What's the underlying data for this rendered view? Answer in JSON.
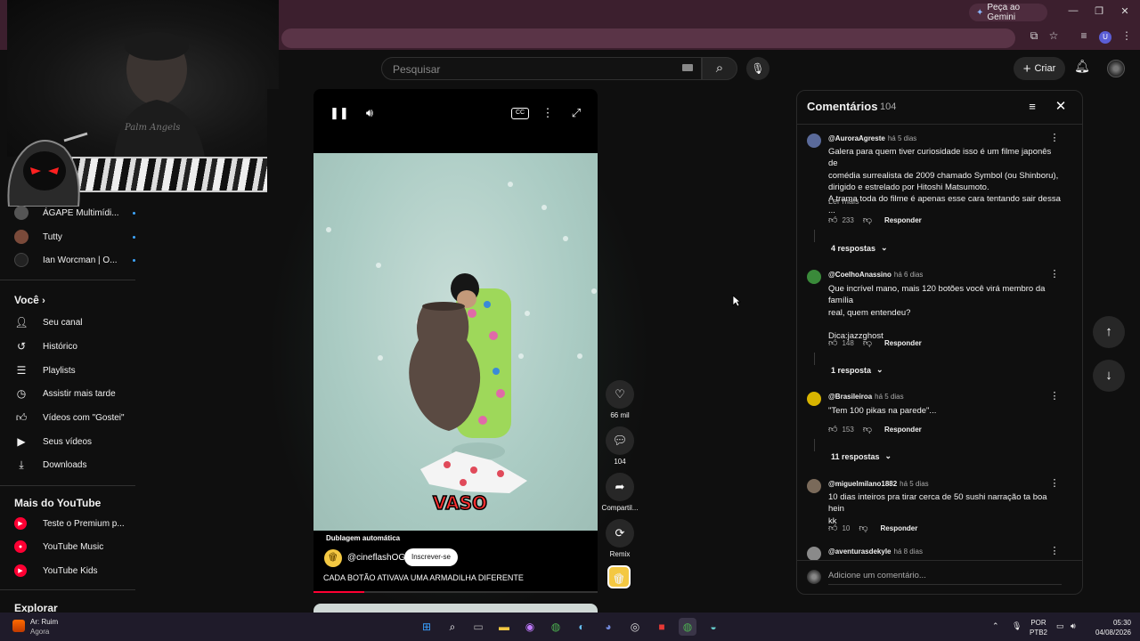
{
  "browser": {
    "gemini_label": "Peça ao Gemini",
    "profile_initial": "U"
  },
  "header": {
    "search_placeholder": "Pesquisar",
    "create_label": "Criar"
  },
  "webcam": {
    "shirt_text": "Palm Angels"
  },
  "sidebar": {
    "subscriptions": [
      {
        "label": "ÁGAPE Multimídi...",
        "color": "#555"
      },
      {
        "label": "Tutty",
        "color": "#7a4a3a"
      },
      {
        "label": "Ian Worcman | O...",
        "color": "#222"
      }
    ],
    "you_title": "Você",
    "you_items": [
      {
        "label": "Seu canal",
        "icon": "person-icon"
      },
      {
        "label": "Histórico",
        "icon": "history-icon"
      },
      {
        "label": "Playlists",
        "icon": "playlists-icon"
      },
      {
        "label": "Assistir mais tarde",
        "icon": "clock-icon"
      },
      {
        "label": "Vídeos com \"Gostei\"",
        "icon": "thumbs-up-icon"
      },
      {
        "label": "Seus vídeos",
        "icon": "your-videos-icon"
      },
      {
        "label": "Downloads",
        "icon": "download-icon"
      }
    ],
    "more_title": "Mais do YouTube",
    "more_items": [
      {
        "label": "Teste o Premium p..."
      },
      {
        "label": "YouTube Music"
      },
      {
        "label": "YouTube Kids"
      }
    ],
    "explore_title": "Explorar"
  },
  "short": {
    "overlay_caption": "VASO",
    "dub_label": "Dublagem automática",
    "channel": "@cineflashOG",
    "subscribe_label": "Inscrever-se",
    "title": "CADA BOTÃO ATIVAVA UMA ARMADILHA DIFERENTE",
    "progress_fraction": 0.18,
    "likes": "66 mil",
    "comments": "104",
    "share_label": "Compartil...",
    "remix_label": "Remix"
  },
  "comments": {
    "title": "Comentários",
    "count": "104",
    "input_placeholder": "Adicione um comentário...",
    "reply_label": "Responder",
    "read_more": "Ler mais",
    "items": [
      {
        "author": "@AuroraAgreste",
        "ago": "há 5 dias",
        "lines": [
          "Galera para quem tiver curiosidade isso é um filme japonês de",
          "comédia surrealista de 2009 chamado Symbol (ou Shinboru),",
          "dirigido e estrelado por Hitoshi Matsumoto.",
          "A trama toda do filme é apenas esse cara tentando sair dessa ..."
        ],
        "likes": "233",
        "replies": "4 respostas",
        "avatar": "#5a6a9a"
      },
      {
        "author": "@CoelhoAnassino",
        "ago": "há 6 dias",
        "lines": [
          "Que incrível mano, mais 120 botões você virá membro da família",
          "real, quem entendeu?",
          "",
          "Dica:jazzghost"
        ],
        "likes": "148",
        "replies": "1 resposta",
        "avatar": "#3a8a3a"
      },
      {
        "author": "@Brasileiroa",
        "ago": "há 5 dias",
        "lines": [
          "\"Tem 100 pikas na parede\"..."
        ],
        "likes": "153",
        "replies": "11 respostas",
        "avatar": "#d8b400"
      },
      {
        "author": "@miguelmilano1882",
        "ago": "há 5 dias",
        "lines": [
          "10 dias inteiros pra tirar cerca de 50 sushi narração ta boa hein",
          "kk"
        ],
        "likes": "10",
        "avatar": "#7a6a5a"
      },
      {
        "author": "@aventurasdekyle",
        "ago": "há 8 dias",
        "avatar": "#8a8a8a"
      }
    ]
  },
  "taskbar": {
    "weather_line1": "Ar: Ruim",
    "weather_line2": "Agora",
    "lang_line1": "POR",
    "lang_line2": "PTB2",
    "time": "05:30",
    "date": "04/08/2026"
  }
}
